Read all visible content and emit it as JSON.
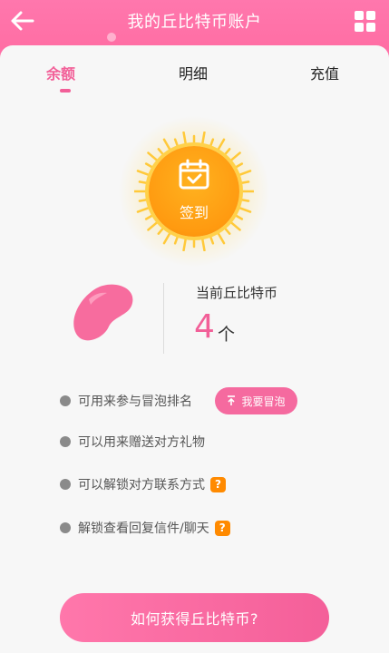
{
  "header": {
    "title": "我的丘比特币账户",
    "back_icon": "arrow-left-icon",
    "menu_icon": "grid-icon"
  },
  "tabs": [
    {
      "label": "余额",
      "active": true
    },
    {
      "label": "明细",
      "active": false
    },
    {
      "label": "充值",
      "active": false
    }
  ],
  "checkin": {
    "label": "签到",
    "icon": "calendar-check-icon"
  },
  "balance": {
    "label": "当前丘比特币",
    "value": "4",
    "unit": "个",
    "icon": "bean-icon"
  },
  "features": [
    {
      "text": "可用来参与冒泡排名"
    },
    {
      "text": "可以用来赠送对方礼物"
    },
    {
      "text": "可以解锁对方联系方式",
      "help": "?"
    },
    {
      "text": "解锁查看回复信件/聊天",
      "help": "?"
    }
  ],
  "bubble_button": {
    "label": "我要冒泡",
    "icon": "arrow-up-icon"
  },
  "cta": {
    "label": "如何获得丘比特币?"
  },
  "colors": {
    "header": "#ff6ea4",
    "accent": "#f25f98",
    "sun": "#ff9a10",
    "help_badge": "#ff8a00"
  }
}
